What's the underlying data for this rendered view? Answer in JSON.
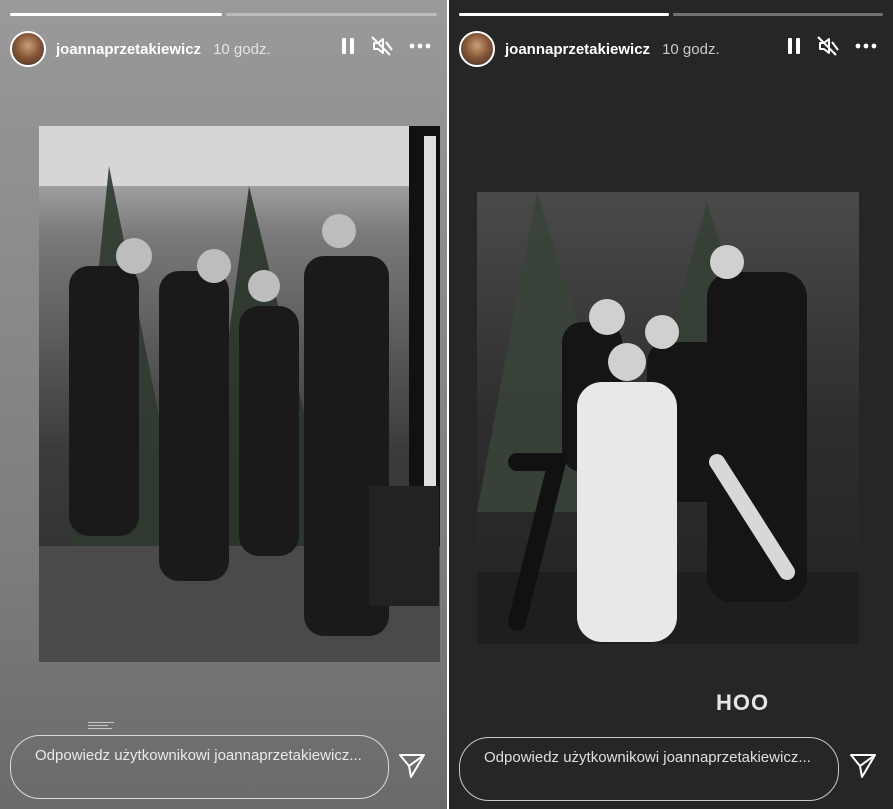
{
  "stories": [
    {
      "progress_segments": [
        1.0,
        0.0
      ],
      "username": "joannaprzetakiewicz",
      "time": "10 godz.",
      "icons": [
        "avatar",
        "pause-icon",
        "mute-icon",
        "more-icon",
        "send-icon"
      ],
      "reply_placeholder": "Odpowiedz użytkownikowi joannaprzetakiewicz..."
    },
    {
      "progress_segments": [
        1.0,
        0.0
      ],
      "username": "joannaprzetakiewicz",
      "time": "10 godz.",
      "sticker_text": "HOO",
      "icons": [
        "avatar",
        "pause-icon",
        "mute-icon",
        "more-icon",
        "send-icon"
      ],
      "reply_placeholder": "Odpowiedz użytkownikowi joannaprzetakiewicz..."
    }
  ],
  "colors": {
    "left_background": "#8c8c8c",
    "right_background": "#262626",
    "text": "#ffffff"
  }
}
